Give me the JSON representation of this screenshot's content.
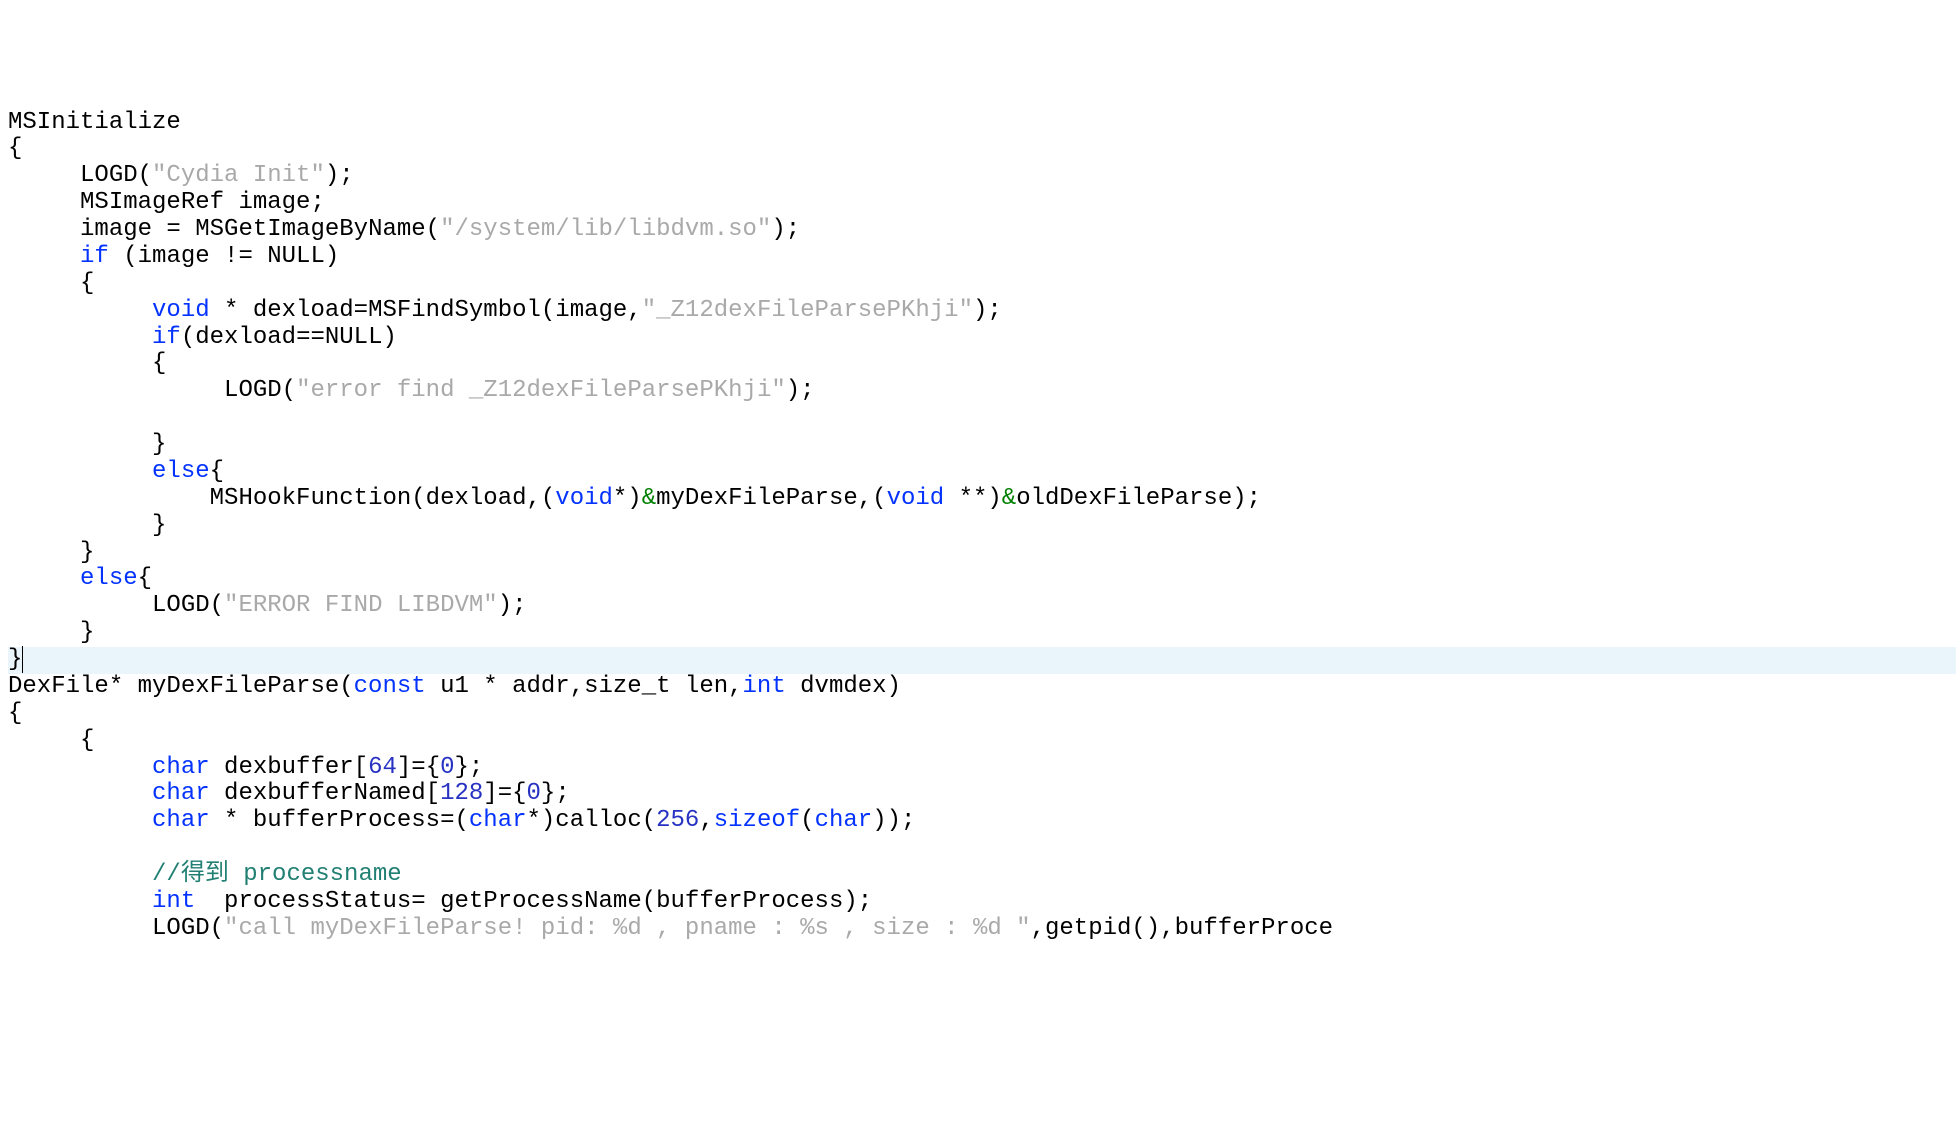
{
  "code": {
    "l1": "MSInitialize",
    "l2": "{",
    "l3_a": "LOGD(",
    "l3_str": "\"Cydia Init\"",
    "l3_b": ");",
    "l4": "MSImageRef image;",
    "l5_a": "image = MSGetImageByName(",
    "l5_str": "\"/system/lib/libdvm.so\"",
    "l5_b": ");",
    "l6_kw": "if",
    "l6_rest": " (image != NULL)",
    "l7": "{",
    "l8_kw": "void",
    "l8_mid": " * dexload=MSFindSymbol(image,",
    "l8_str": "\"_Z12dexFileParsePKhji\"",
    "l8_end": ");",
    "l9_kw": "if",
    "l9_rest": "(dexload==NULL)",
    "l10": "{",
    "l11_a": "LOGD(",
    "l11_str": "\"error find _Z12dexFileParsePKhji\"",
    "l11_b": ");",
    "l12": "",
    "l13": "}",
    "l14_kw": "else",
    "l14_rest": "{",
    "l15_a": "MSHookFunction(dexload,(",
    "l15_kw1": "void",
    "l15_b": "*)",
    "l15_amp1": "&",
    "l15_c": "myDexFileParse,(",
    "l15_kw2": "void",
    "l15_d": " **)",
    "l15_amp2": "&",
    "l15_e": "oldDexFileParse);",
    "l16": "}",
    "l17": "}",
    "l18_kw": "else",
    "l18_rest": "{",
    "l19_a": "LOGD(",
    "l19_str": "\"ERROR FIND LIBDVM\"",
    "l19_b": ");",
    "l20": "}",
    "l21": "}",
    "l22_a": "DexFile* myDexFileParse(",
    "l22_kw1": "const",
    "l22_b": " u1 * addr,size_t len,",
    "l22_kw2": "int",
    "l22_c": " dvmdex)",
    "l23": "{",
    "l24": "{",
    "l25_kw": "char",
    "l25_mid": " dexbuffer[",
    "l25_num": "64",
    "l25_mid2": "]={",
    "l25_num2": "0",
    "l25_end": "};",
    "l26_kw": "char",
    "l26_mid": " dexbufferNamed[",
    "l26_num": "128",
    "l26_mid2": "]={",
    "l26_num2": "0",
    "l26_end": "};",
    "l27_kw1": "char",
    "l27_a": " * bufferProcess=(",
    "l27_kw2": "char",
    "l27_b": "*)calloc(",
    "l27_num1": "256",
    "l27_c": ",",
    "l27_kw3": "sizeof",
    "l27_d": "(",
    "l27_kw4": "char",
    "l27_e": "));",
    "l28": "",
    "l29_comment": "//得到 processname",
    "l30_kw": "int",
    "l30_rest": "  processStatus= getProcessName(bufferProcess);",
    "l31_a": "LOGD(",
    "l31_str": "\"call myDexFileParse! pid: %d , pname : %s , size : %d \"",
    "l31_b": ",getpid(),bufferProce"
  }
}
